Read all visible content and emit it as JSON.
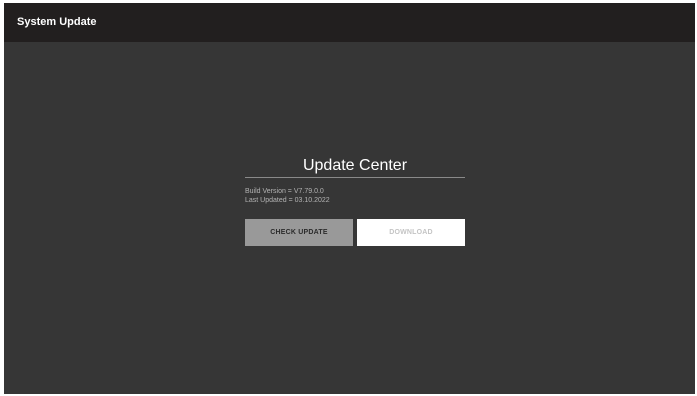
{
  "window": {
    "title": "System Update"
  },
  "update_center": {
    "heading": "Update Center",
    "build_version": "Build Version = V7.79.0.0",
    "last_updated": "Last Updated = 03.10.2022",
    "buttons": {
      "check_update": "CHECK UPDATE",
      "download": "DOWNLOAD"
    }
  },
  "colors": {
    "titlebar_bg": "#221f1f",
    "window_bg": "#363636",
    "check_button_bg": "#999999",
    "download_button_bg": "#ffffff"
  }
}
